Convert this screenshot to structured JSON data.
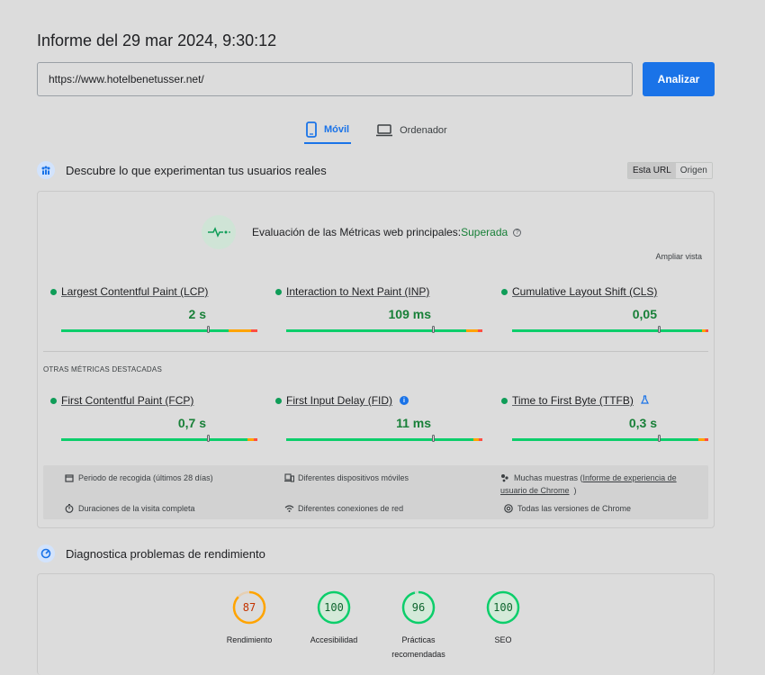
{
  "header": {
    "title": "Informe del 29 mar 2024, 9:30:12"
  },
  "url_input": {
    "value": "https://www.hotelbenetusser.net/"
  },
  "analyze_button": {
    "label": "Analizar"
  },
  "tabs": [
    {
      "label": "Móvil",
      "icon": "smartphone-icon",
      "active": true
    },
    {
      "label": "Ordenador",
      "icon": "laptop-icon",
      "active": false
    }
  ],
  "real_users": {
    "heading": "Descubre lo que experimentan tus usuarios reales",
    "toggle": {
      "this_url": "Esta URL",
      "origin": "Origen"
    },
    "evaluation_prefix": "Evaluación de las Métricas web principales:",
    "evaluation_result": "Superada",
    "expand_label": "Ampliar vista",
    "core_metrics": [
      {
        "name": "Largest Contentful Paint (LCP)",
        "value": "2 s"
      },
      {
        "name": "Interaction to Next Paint (INP)",
        "value": "109 ms"
      },
      {
        "name": "Cumulative Layout Shift (CLS)",
        "value": "0,05"
      }
    ],
    "other_title": "OTRAS MÉTRICAS DESTACADAS",
    "other_metrics": [
      {
        "name": "First Contentful Paint (FCP)",
        "value": "0,7 s"
      },
      {
        "name": "First Input Delay (FID)",
        "value": "11 ms",
        "badge_icon": "info-icon"
      },
      {
        "name": "Time to First Byte (TTFB)",
        "value": "0,3 s",
        "badge_icon": "flask-icon"
      }
    ],
    "info": {
      "period": "Periodo de recogida (últimos 28 días)",
      "devices": "Diferentes dispositivos móviles",
      "samples_prefix": "Muchas muestras (",
      "samples_link_1": "Informe de experiencia de",
      "samples_link_2": "usuario de Chrome",
      "samples_suffix": ")",
      "duration": "Duraciones de la visita completa",
      "network": "Diferentes conexiones de red",
      "versions": "Todas las versiones de Chrome"
    }
  },
  "diagnose": {
    "heading": "Diagnostica problemas de rendimiento",
    "scores": [
      {
        "value": "87",
        "label": "Rendimiento",
        "status": "average"
      },
      {
        "value": "100",
        "label": "Accesibilidad",
        "status": "good"
      },
      {
        "value": "96",
        "label": "Prácticas recomendadas",
        "status": "good"
      },
      {
        "value": "100",
        "label": "SEO",
        "status": "good"
      }
    ]
  },
  "colors": {
    "accent": "#1a73e8",
    "good": "#0cce6b",
    "good_text": "#188038",
    "average": "#ffa400",
    "average_text": "#c33300",
    "poor": "#ff4e42"
  }
}
